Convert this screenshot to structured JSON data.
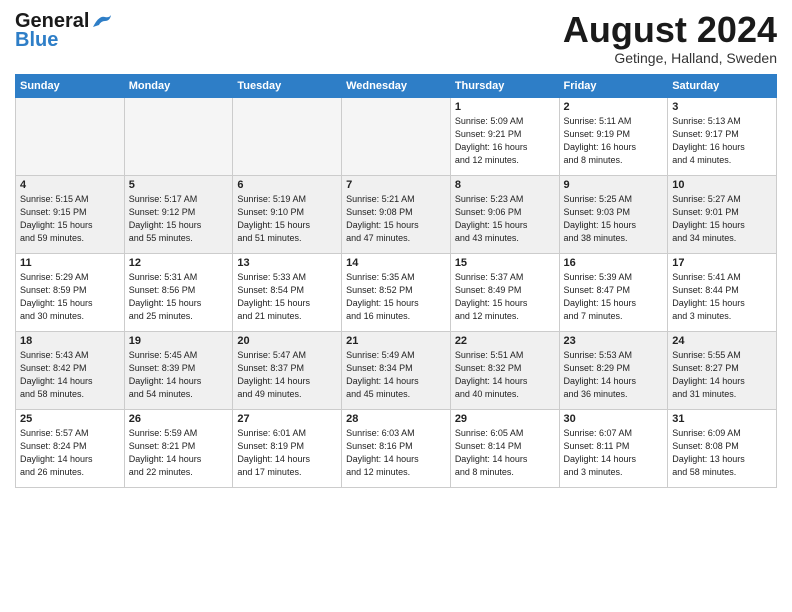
{
  "header": {
    "logo_general": "General",
    "logo_blue": "Blue",
    "month_title": "August 2024",
    "subtitle": "Getinge, Halland, Sweden"
  },
  "weekdays": [
    "Sunday",
    "Monday",
    "Tuesday",
    "Wednesday",
    "Thursday",
    "Friday",
    "Saturday"
  ],
  "weeks": [
    [
      {
        "num": "",
        "info": ""
      },
      {
        "num": "",
        "info": ""
      },
      {
        "num": "",
        "info": ""
      },
      {
        "num": "",
        "info": ""
      },
      {
        "num": "1",
        "info": "Sunrise: 5:09 AM\nSunset: 9:21 PM\nDaylight: 16 hours\nand 12 minutes."
      },
      {
        "num": "2",
        "info": "Sunrise: 5:11 AM\nSunset: 9:19 PM\nDaylight: 16 hours\nand 8 minutes."
      },
      {
        "num": "3",
        "info": "Sunrise: 5:13 AM\nSunset: 9:17 PM\nDaylight: 16 hours\nand 4 minutes."
      }
    ],
    [
      {
        "num": "4",
        "info": "Sunrise: 5:15 AM\nSunset: 9:15 PM\nDaylight: 15 hours\nand 59 minutes."
      },
      {
        "num": "5",
        "info": "Sunrise: 5:17 AM\nSunset: 9:12 PM\nDaylight: 15 hours\nand 55 minutes."
      },
      {
        "num": "6",
        "info": "Sunrise: 5:19 AM\nSunset: 9:10 PM\nDaylight: 15 hours\nand 51 minutes."
      },
      {
        "num": "7",
        "info": "Sunrise: 5:21 AM\nSunset: 9:08 PM\nDaylight: 15 hours\nand 47 minutes."
      },
      {
        "num": "8",
        "info": "Sunrise: 5:23 AM\nSunset: 9:06 PM\nDaylight: 15 hours\nand 43 minutes."
      },
      {
        "num": "9",
        "info": "Sunrise: 5:25 AM\nSunset: 9:03 PM\nDaylight: 15 hours\nand 38 minutes."
      },
      {
        "num": "10",
        "info": "Sunrise: 5:27 AM\nSunset: 9:01 PM\nDaylight: 15 hours\nand 34 minutes."
      }
    ],
    [
      {
        "num": "11",
        "info": "Sunrise: 5:29 AM\nSunset: 8:59 PM\nDaylight: 15 hours\nand 30 minutes."
      },
      {
        "num": "12",
        "info": "Sunrise: 5:31 AM\nSunset: 8:56 PM\nDaylight: 15 hours\nand 25 minutes."
      },
      {
        "num": "13",
        "info": "Sunrise: 5:33 AM\nSunset: 8:54 PM\nDaylight: 15 hours\nand 21 minutes."
      },
      {
        "num": "14",
        "info": "Sunrise: 5:35 AM\nSunset: 8:52 PM\nDaylight: 15 hours\nand 16 minutes."
      },
      {
        "num": "15",
        "info": "Sunrise: 5:37 AM\nSunset: 8:49 PM\nDaylight: 15 hours\nand 12 minutes."
      },
      {
        "num": "16",
        "info": "Sunrise: 5:39 AM\nSunset: 8:47 PM\nDaylight: 15 hours\nand 7 minutes."
      },
      {
        "num": "17",
        "info": "Sunrise: 5:41 AM\nSunset: 8:44 PM\nDaylight: 15 hours\nand 3 minutes."
      }
    ],
    [
      {
        "num": "18",
        "info": "Sunrise: 5:43 AM\nSunset: 8:42 PM\nDaylight: 14 hours\nand 58 minutes."
      },
      {
        "num": "19",
        "info": "Sunrise: 5:45 AM\nSunset: 8:39 PM\nDaylight: 14 hours\nand 54 minutes."
      },
      {
        "num": "20",
        "info": "Sunrise: 5:47 AM\nSunset: 8:37 PM\nDaylight: 14 hours\nand 49 minutes."
      },
      {
        "num": "21",
        "info": "Sunrise: 5:49 AM\nSunset: 8:34 PM\nDaylight: 14 hours\nand 45 minutes."
      },
      {
        "num": "22",
        "info": "Sunrise: 5:51 AM\nSunset: 8:32 PM\nDaylight: 14 hours\nand 40 minutes."
      },
      {
        "num": "23",
        "info": "Sunrise: 5:53 AM\nSunset: 8:29 PM\nDaylight: 14 hours\nand 36 minutes."
      },
      {
        "num": "24",
        "info": "Sunrise: 5:55 AM\nSunset: 8:27 PM\nDaylight: 14 hours\nand 31 minutes."
      }
    ],
    [
      {
        "num": "25",
        "info": "Sunrise: 5:57 AM\nSunset: 8:24 PM\nDaylight: 14 hours\nand 26 minutes."
      },
      {
        "num": "26",
        "info": "Sunrise: 5:59 AM\nSunset: 8:21 PM\nDaylight: 14 hours\nand 22 minutes."
      },
      {
        "num": "27",
        "info": "Sunrise: 6:01 AM\nSunset: 8:19 PM\nDaylight: 14 hours\nand 17 minutes."
      },
      {
        "num": "28",
        "info": "Sunrise: 6:03 AM\nSunset: 8:16 PM\nDaylight: 14 hours\nand 12 minutes."
      },
      {
        "num": "29",
        "info": "Sunrise: 6:05 AM\nSunset: 8:14 PM\nDaylight: 14 hours\nand 8 minutes."
      },
      {
        "num": "30",
        "info": "Sunrise: 6:07 AM\nSunset: 8:11 PM\nDaylight: 14 hours\nand 3 minutes."
      },
      {
        "num": "31",
        "info": "Sunrise: 6:09 AM\nSunset: 8:08 PM\nDaylight: 13 hours\nand 58 minutes."
      }
    ]
  ]
}
